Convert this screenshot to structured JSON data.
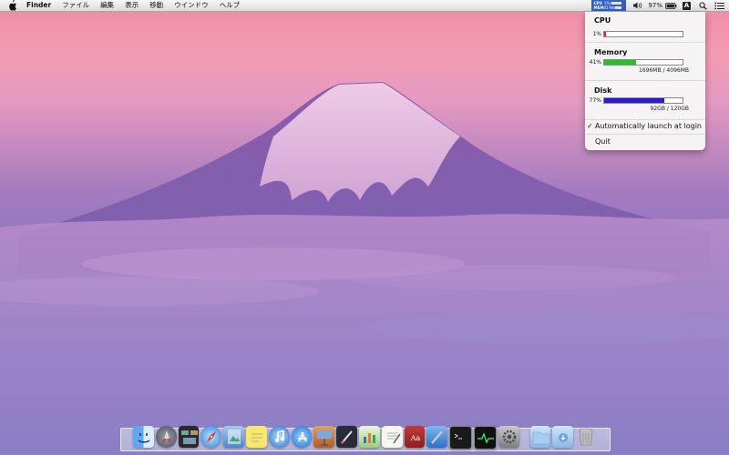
{
  "menubar": {
    "app_name": "Finder",
    "items": [
      "ファイル",
      "編集",
      "表示",
      "移動",
      "ウインドウ",
      "ヘルプ"
    ],
    "status": {
      "sysmon": {
        "cpu_label": "CPU",
        "cpu_value": "1%",
        "cpu_fraction": 0.01,
        "mem_label": "MEM",
        "mem_value": "41%",
        "mem_fraction": 0.41
      },
      "battery_percent": "97%",
      "input_method_letter": "A",
      "icons": [
        "volume-icon",
        "battery-icon",
        "input-method-icon",
        "spotlight-icon",
        "notification-list-icon"
      ]
    }
  },
  "dropdown": {
    "cpu": {
      "title": "CPU",
      "percent": "1%",
      "fraction": 0.01,
      "color": "#e0202a"
    },
    "memory": {
      "title": "Memory",
      "percent": "41%",
      "fraction": 0.41,
      "detail": "1696MB / 4096MB",
      "color": "#22c422"
    },
    "disk": {
      "title": "Disk",
      "percent": "77%",
      "fraction": 0.77,
      "detail": "92GB / 120GB",
      "color": "#2a19d8"
    },
    "launch_checkmark": "✓",
    "launch_label": "Automatically launch at login",
    "quit_label": "Quit"
  },
  "dock": {
    "apps": [
      "finder",
      "launchpad",
      "mission-control",
      "safari",
      "preview",
      "stickies",
      "itunes",
      "app-store",
      "keynote",
      "pixelmator",
      "numbers",
      "textedit",
      "dictionary",
      "xcode",
      "terminal",
      "activity-monitor",
      "system-preferences",
      "applications-folder",
      "downloads-folder",
      "trash"
    ]
  },
  "colors": {
    "sysmon_bg": "#2f5fc6",
    "menubar_bg": "#ececec"
  }
}
